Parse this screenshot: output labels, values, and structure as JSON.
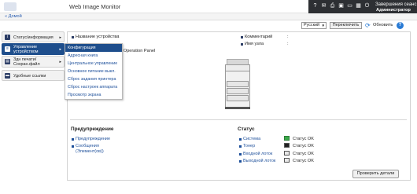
{
  "header": {
    "app_title": "Web Image Monitor",
    "logout": "Завершения сеанс",
    "user": "Администратор"
  },
  "home": {
    "label": "Домой"
  },
  "toolbar": {
    "language": "Русский",
    "switch": "Переключить",
    "refresh": "Обновить",
    "help": "?"
  },
  "sidebar": {
    "items": [
      {
        "label": "Статус/информация",
        "icon": "i"
      },
      {
        "label": "Управление устройством",
        "icon": "≡"
      },
      {
        "label": "Здн печати/Сохран.файл",
        "icon": "▤"
      },
      {
        "label": "Удобные ссылки",
        "icon": "▬"
      }
    ]
  },
  "dropdown": {
    "items": [
      "Конфигурация",
      "Адресная книга",
      "Центральное управление",
      "Основное питание выкл.",
      "Сброс задания принтера",
      "Сброс настроек аппарата",
      "Просмотр экрана"
    ]
  },
  "device_info": {
    "device_name_label": "Название устройства",
    "device_name_value": ":",
    "comment_label": "Комментарий",
    "comment_value": ":",
    "host_label": "Имя узла",
    "host_value": ":",
    "smart_panel": "mart Operation Panel"
  },
  "warning": {
    "title": "Предупреждение",
    "links": [
      "Предупреждение",
      "Сообщения",
      "(Элемент(ов))"
    ]
  },
  "status": {
    "title": "Статус",
    "rows": [
      {
        "label": "Система",
        "value": "Статус OK"
      },
      {
        "label": "Тонер",
        "value": "Статус OK"
      },
      {
        "label": "Входной лоток",
        "value": "Статус OK"
      },
      {
        "label": "Выходной лоток",
        "value": "Статус OK"
      }
    ]
  },
  "details_button": "Проверить детали"
}
